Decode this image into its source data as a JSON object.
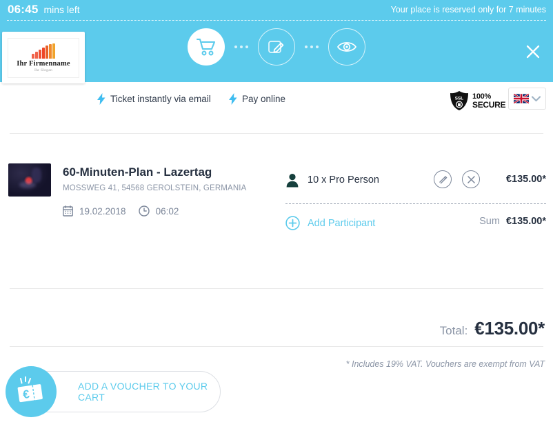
{
  "timer": {
    "value": "06:45",
    "unit": "mins left",
    "reservation_note": "Your place is reserved only for 7 minutes"
  },
  "logo": {
    "name": "Ihr Firmenname",
    "slogan": "Ihr Slogan"
  },
  "steps": [
    {
      "name": "cart-step",
      "icon": "shopping-cart-icon",
      "state": "active"
    },
    {
      "name": "details-step",
      "icon": "edit-pencil-icon",
      "state": "idle"
    },
    {
      "name": "review-step",
      "icon": "eye-icon",
      "state": "idle"
    }
  ],
  "header": {
    "close_label": "✕"
  },
  "features": [
    {
      "icon": "bolt-icon",
      "label": "Ticket instantly via email"
    },
    {
      "icon": "bolt-icon",
      "label": "Pay online"
    }
  ],
  "ssl": {
    "shield_text": "SSL",
    "line1": "100%",
    "line2": "SECURE"
  },
  "language": {
    "flag": "uk-flag-icon",
    "chevron": "chevron-down-icon"
  },
  "item": {
    "title": "60-Minuten-Plan - Lazertag",
    "address": "MOSSWEG 41, 54568 GEROLSTEIN, GERMANIA",
    "date_icon": "calendar-icon",
    "date": "19.02.2018",
    "time_icon": "clock-icon",
    "time": "06:02",
    "thumbnail": "lasertag-photo"
  },
  "participants": {
    "person_icon": "person-icon",
    "label": "10 x Pro Person",
    "edit_icon": "pencil-icon",
    "delete_icon": "close-circle-icon",
    "price": "€135.00*",
    "add_icon": "plus-circle-icon",
    "add_label": "Add Participant",
    "sum_label": "Sum",
    "sum_value": "€135.00*"
  },
  "totals": {
    "label": "Total:",
    "value": "€135.00*",
    "vat_note": "* Includes 19% VAT. Vouchers are exempt from VAT"
  },
  "voucher": {
    "icon": "voucher-euro-ticket-icon",
    "label": "ADD A VOUCHER TO YOUR CART"
  },
  "colors": {
    "brand_blue": "#5ccbec",
    "text_dark": "#263040",
    "text_muted": "#8b95a6",
    "icon_gray": "#7b8699"
  }
}
